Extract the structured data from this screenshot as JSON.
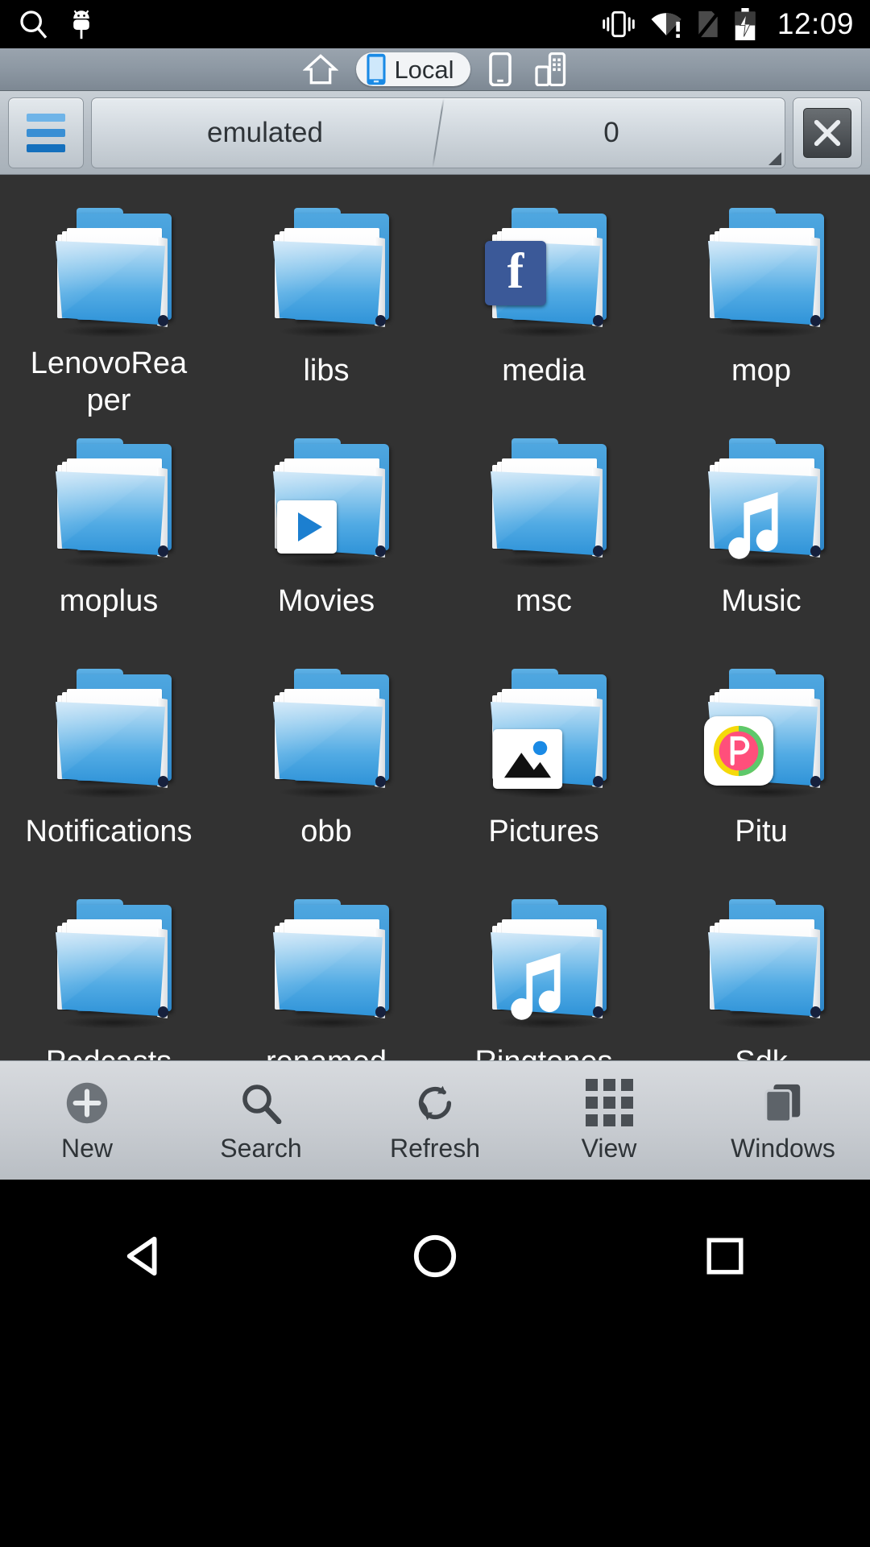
{
  "status_bar": {
    "clock": "12:09",
    "left_icons": [
      "search-icon",
      "android-debug-icon"
    ],
    "right_icons": [
      "vibrate-icon",
      "wifi-alert-icon",
      "no-sim-icon",
      "battery-charging-icon"
    ]
  },
  "tab_strip": {
    "home_icon": "home-icon",
    "active_tab": "Local",
    "device_icon": "phone-icon",
    "network_icon": "network-devices-icon"
  },
  "path_bar": {
    "menu_icon": "hamburger-menu-icon",
    "crumbs": [
      "emulated",
      "0"
    ],
    "close_label": "✕"
  },
  "files": [
    {
      "name": "LenovoReaper",
      "type": "folder",
      "badge": "none"
    },
    {
      "name": "libs",
      "type": "folder",
      "badge": "none"
    },
    {
      "name": "media",
      "type": "folder",
      "badge": "facebook-icon"
    },
    {
      "name": "mop",
      "type": "folder",
      "badge": "none"
    },
    {
      "name": "moplus",
      "type": "folder",
      "badge": "none"
    },
    {
      "name": "Movies",
      "type": "folder",
      "badge": "video-play-icon"
    },
    {
      "name": "msc",
      "type": "folder",
      "badge": "none"
    },
    {
      "name": "Music",
      "type": "folder",
      "badge": "music-note-icon"
    },
    {
      "name": "Notifications",
      "type": "folder",
      "badge": "none"
    },
    {
      "name": "obb",
      "type": "folder",
      "badge": "none"
    },
    {
      "name": "Pictures",
      "type": "folder",
      "badge": "image-icon"
    },
    {
      "name": "Pitu",
      "type": "folder",
      "badge": "pitu-app-icon"
    },
    {
      "name": "Podcasts",
      "type": "folder",
      "badge": "none"
    },
    {
      "name": "renamed",
      "type": "folder",
      "badge": "none"
    },
    {
      "name": "Ringtones",
      "type": "folder",
      "badge": "music-note-icon"
    },
    {
      "name": "Sdk",
      "type": "folder",
      "badge": "none"
    }
  ],
  "toolbar": [
    {
      "label": "New",
      "icon": "plus-circle-icon"
    },
    {
      "label": "Search",
      "icon": "search-icon"
    },
    {
      "label": "Refresh",
      "icon": "refresh-icon"
    },
    {
      "label": "View",
      "icon": "grid-view-icon"
    },
    {
      "label": "Windows",
      "icon": "windows-stack-icon"
    }
  ],
  "nav_bar": {
    "back": "back-triangle-icon",
    "home": "home-circle-icon",
    "recents": "recents-square-icon"
  },
  "colors": {
    "grid_background": "#323232",
    "folder_blue": "#3f9ad8",
    "accent_blue": "#1570bd",
    "facebook_blue": "#3b5998",
    "toolbar_gray": "#c8ccd1"
  }
}
